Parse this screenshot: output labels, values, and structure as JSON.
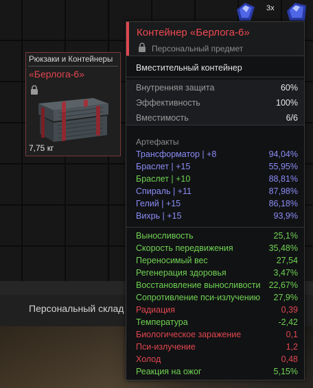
{
  "storage": {
    "label": "Персональный склад"
  },
  "top_items": {
    "stack_count": "3x"
  },
  "item": {
    "category": "Рюкзаки и Контейнеры",
    "name": "«Берлога-6»",
    "weight": "7,75 кг",
    "lock_icon": "lock-icon",
    "image_icon": "chest-icon"
  },
  "tooltip": {
    "title": "Контейнер «Берлога-6»",
    "subtitle": "Персональный предмет",
    "type": "Вместительный контейнер",
    "stats": [
      {
        "label": "Внутренняя защита",
        "value": "60%"
      },
      {
        "label": "Эффективность",
        "value": "100%"
      },
      {
        "label": "Вместимость",
        "value": "6/6"
      }
    ],
    "artifacts_title": "Артефакты",
    "artifacts": [
      {
        "label": "Трансформатор | +8",
        "value": "94,04%",
        "color": "blue"
      },
      {
        "label": "Браслет | +15",
        "value": "55,95%",
        "color": "blue"
      },
      {
        "label": "Браслет | +10",
        "value": "88,81%",
        "color": "green"
      },
      {
        "label": "Спираль | +11",
        "value": "87,98%",
        "color": "blue"
      },
      {
        "label": "Гелий | +15",
        "value": "86,18%",
        "color": "blue"
      },
      {
        "label": "Вихрь | +15",
        "value": "93,9%",
        "color": "blue"
      }
    ],
    "effects": [
      {
        "label": "Выносливость",
        "value": "25,1%",
        "color": "green"
      },
      {
        "label": "Скорость передвижения",
        "value": "35,48%",
        "color": "green"
      },
      {
        "label": "Переносимый вес",
        "value": "27,54",
        "color": "green"
      },
      {
        "label": "Регенерация здоровья",
        "value": "3,47%",
        "color": "green"
      },
      {
        "label": "Восстановление выносливости",
        "value": "22,67%",
        "color": "green"
      },
      {
        "label": "Сопротивление пси-излучению",
        "value": "27,9%",
        "color": "green"
      },
      {
        "label": "Радиация",
        "value": "0,39",
        "color": "red"
      },
      {
        "label": "Температура",
        "value": "-2,42",
        "color": "green"
      },
      {
        "label": "Биологическое заражение",
        "value": "0,1",
        "color": "red"
      },
      {
        "label": "Пси-излучение",
        "value": "1,2",
        "color": "red"
      },
      {
        "label": "Холод",
        "value": "0,48",
        "color": "red"
      },
      {
        "label": "Реакция на ожог",
        "value": "5,15%",
        "color": "green"
      }
    ]
  },
  "colors": {
    "accent_red": "#e0474f",
    "artifact_blue": "#8b8df6",
    "positive_green": "#70d352",
    "negative_red": "#e0474f"
  }
}
